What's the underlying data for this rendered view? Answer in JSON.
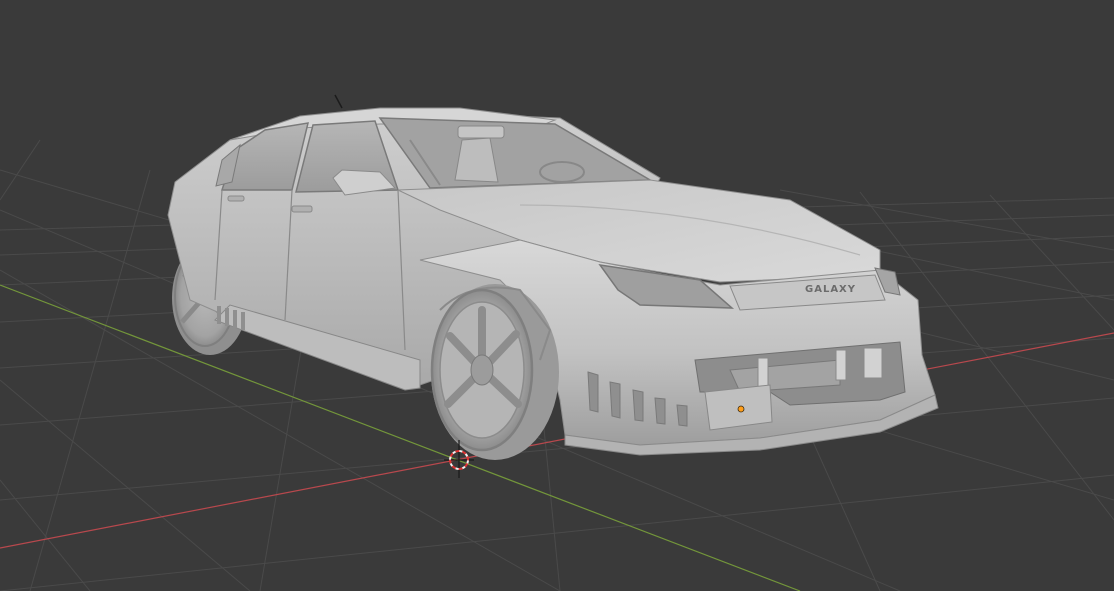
{
  "viewport": {
    "background": "#3a3a3a",
    "grid_color": "#4a4a4a",
    "x_axis_color": "#c24a4f",
    "y_axis_color": "#7fa13a",
    "origin_color": "#f0f0f0",
    "selection_origin_color": "#ff9e1b"
  },
  "object": {
    "name": "car-sedan-model",
    "shading": "solid",
    "base_color": "#c8c8c8",
    "grille_badge": "GALAXY"
  }
}
